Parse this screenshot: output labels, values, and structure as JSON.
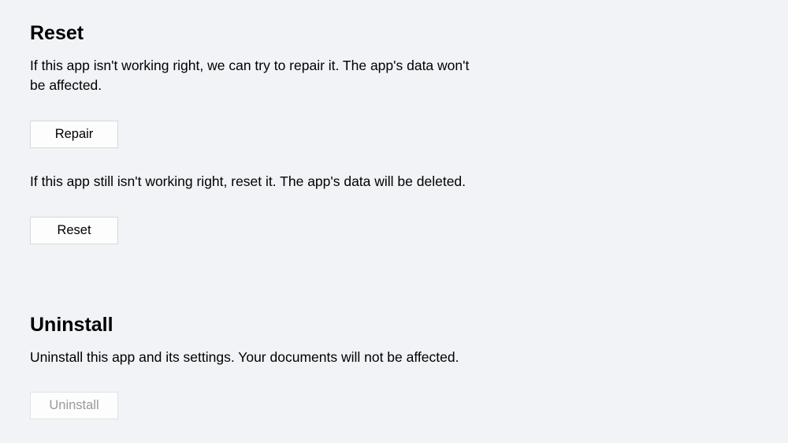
{
  "reset": {
    "title": "Reset",
    "repair_description": "If this app isn't working right, we can try to repair it. The app's data won't be affected.",
    "repair_button_label": "Repair",
    "reset_description": "If this app still isn't working right, reset it. The app's data will be deleted.",
    "reset_button_label": "Reset"
  },
  "uninstall": {
    "title": "Uninstall",
    "description": "Uninstall this app and its settings. Your documents will not be affected.",
    "button_label": "Uninstall"
  }
}
